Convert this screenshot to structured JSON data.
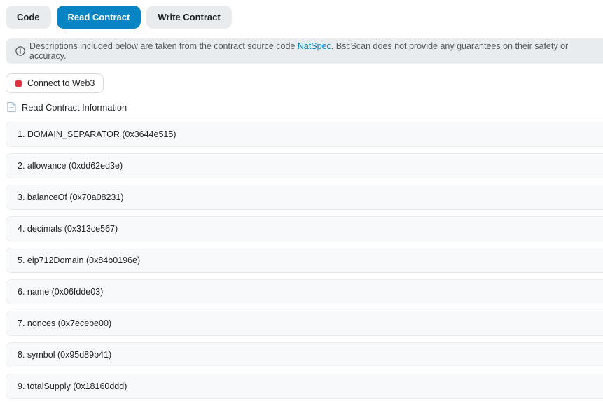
{
  "tabs": [
    {
      "label": "Code",
      "active": false
    },
    {
      "label": "Read Contract",
      "active": true
    },
    {
      "label": "Write Contract",
      "active": false
    }
  ],
  "alert": {
    "text_before_link": "Descriptions included below are taken from the contract source code ",
    "link_label": "NatSpec",
    "text_after_link": ". BscScan does not provide any guarantees on their safety or accuracy."
  },
  "connect": {
    "label": "Connect to Web3"
  },
  "section": {
    "title": "Read Contract Information"
  },
  "functions": [
    {
      "label": "1. DOMAIN_SEPARATOR (0x3644e515)"
    },
    {
      "label": "2. allowance (0xdd62ed3e)"
    },
    {
      "label": "3. balanceOf (0x70a08231)"
    },
    {
      "label": "4. decimals (0x313ce567)"
    },
    {
      "label": "5. eip712Domain (0x84b0196e)"
    },
    {
      "label": "6. name (0x06fdde03)"
    },
    {
      "label": "7. nonces (0x7ecebe00)"
    },
    {
      "label": "8. symbol (0x95d89b41)"
    },
    {
      "label": "9. totalSupply (0x18160ddd)"
    }
  ],
  "colors": {
    "accent_blue": "#0784c3",
    "tab_inactive_bg": "#e9ecef",
    "alert_bg": "#e9ecef",
    "accordion_bg": "#f8f9fa",
    "accordion_border": "#e9ecef",
    "status_red_dot": "#dc3545",
    "text_dark": "#212529",
    "text_muted": "#54595f"
  }
}
